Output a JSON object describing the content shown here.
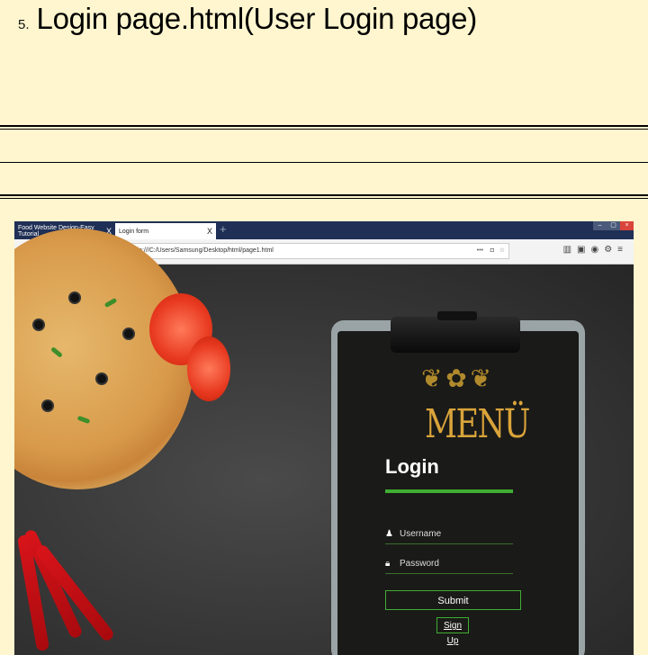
{
  "heading": {
    "number": "5.",
    "title": "Login page.html(User Login page)"
  },
  "browser": {
    "tabs": [
      {
        "label": "Food Website Design-Easy Tutorial",
        "close": "X"
      },
      {
        "label": "Login form",
        "close": "X"
      }
    ],
    "new_tab": "+",
    "url": "file:///C:/Users/Samsung/Desktop/html/page1.html",
    "url_more": "•••"
  },
  "login": {
    "menu_sign": "MENÜ",
    "title": "Login",
    "username_placeholder": "Username",
    "password_placeholder": "Password",
    "submit_label": "Submit",
    "signup_label": "Sign Up"
  },
  "colors": {
    "page_bg": "#fff6cf",
    "accent_green": "#3fae33",
    "menu_gold": "#d9a43a"
  }
}
